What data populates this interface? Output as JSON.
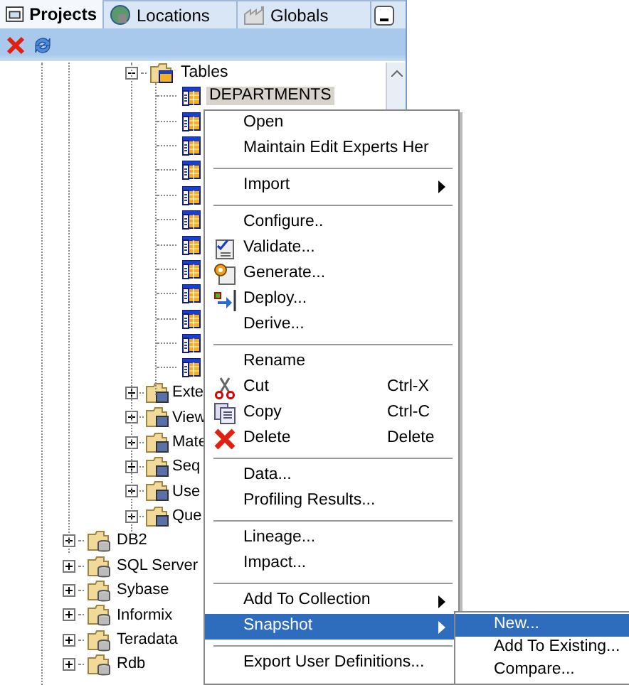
{
  "tabs": [
    {
      "label": "Projects",
      "selected": true
    },
    {
      "label": "Locations",
      "selected": false
    },
    {
      "label": "Globals",
      "selected": false
    }
  ],
  "tree": {
    "items": [
      {
        "label": "Tables",
        "expanded": true,
        "kind": "tables",
        "children": [
          {
            "label": "DEPARTMENTS",
            "selected": true
          },
          {
            "selected": false
          },
          {
            "selected": false
          },
          {
            "selected": false
          },
          {
            "selected": false
          },
          {
            "selected": false
          },
          {
            "selected": false
          },
          {
            "selected": false
          },
          {
            "selected": false
          },
          {
            "selected": false
          },
          {
            "selected": false
          },
          {
            "selected": false
          }
        ]
      },
      {
        "label": "Exte",
        "expanded": false,
        "kind": "folder"
      },
      {
        "label": "View",
        "expanded": false,
        "kind": "folder"
      },
      {
        "label": "Mate",
        "expanded": false,
        "kind": "folder"
      },
      {
        "label": "Seq",
        "expanded": false,
        "kind": "folder"
      },
      {
        "label": "Use",
        "expanded": false,
        "kind": "folder"
      },
      {
        "label": "Que",
        "expanded": false,
        "kind": "folder"
      }
    ],
    "modules": [
      {
        "label": "DB2",
        "expanded": false
      },
      {
        "label": "SQL Server",
        "expanded": false
      },
      {
        "label": "Sybase",
        "expanded": false
      },
      {
        "label": "Informix",
        "expanded": false
      },
      {
        "label": "Teradata",
        "expanded": false
      },
      {
        "label": "Rdb",
        "expanded": false
      }
    ]
  },
  "context_menu": [
    {
      "kind": "item",
      "label": "Open"
    },
    {
      "kind": "item",
      "label": "Maintain Edit Experts Her"
    },
    {
      "kind": "separator"
    },
    {
      "kind": "submenu",
      "label": "Import",
      "selected": false
    },
    {
      "kind": "separator"
    },
    {
      "kind": "item",
      "label": "Configure.."
    },
    {
      "kind": "item",
      "label": "Validate..."
    },
    {
      "kind": "item",
      "label": "Generate..."
    },
    {
      "kind": "item",
      "label": "Deploy..."
    },
    {
      "kind": "item",
      "label": "Derive..."
    },
    {
      "kind": "separator"
    },
    {
      "kind": "item",
      "label": "Rename"
    },
    {
      "kind": "item",
      "label": "Cut",
      "shortcut": "Ctrl-X"
    },
    {
      "kind": "item",
      "label": "Copy",
      "shortcut": "Ctrl-C"
    },
    {
      "kind": "item",
      "label": "Delete",
      "shortcut": "Delete"
    },
    {
      "kind": "separator"
    },
    {
      "kind": "item",
      "label": "Data..."
    },
    {
      "kind": "item",
      "label": "Profiling Results..."
    },
    {
      "kind": "separator"
    },
    {
      "kind": "item",
      "label": "Lineage..."
    },
    {
      "kind": "item",
      "label": "Impact..."
    },
    {
      "kind": "separator"
    },
    {
      "kind": "submenu",
      "label": "Add To Collection",
      "selected": false
    },
    {
      "kind": "submenu",
      "label": "Snapshot",
      "selected": true
    },
    {
      "kind": "separator"
    },
    {
      "kind": "item",
      "label": "Export User Definitions..."
    }
  ],
  "submenu": [
    {
      "label": "New...",
      "selected": true
    },
    {
      "label": "Add To Existing...",
      "selected": false
    },
    {
      "label": "Compare...",
      "selected": false
    }
  ]
}
